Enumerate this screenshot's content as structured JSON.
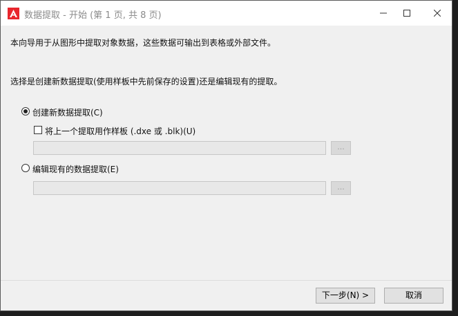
{
  "window": {
    "title": "数据提取 - 开始 (第 1 页, 共 8 页)"
  },
  "content": {
    "intro": "本向导用于从图形中提取对象数据，这些数据可输出到表格或外部文件。",
    "question": "选择是创建新数据提取(使用样板中先前保存的设置)还是编辑现有的提取。",
    "option_create": {
      "label": "创建新数据提取(C)",
      "selected": true
    },
    "checkbox_template": {
      "label": "将上一个提取用作样板 (.dxe 或 .blk)(U)",
      "checked": false
    },
    "option_edit": {
      "label": "编辑现有的数据提取(E)",
      "selected": false
    },
    "browse_label": "..."
  },
  "buttons": {
    "next": "下一步(N) >",
    "cancel": "取消"
  },
  "colors": {
    "dialog_bg": "#f0f0f0",
    "titlebar_bg": "#ffffff",
    "autocad_red": "#e8262c"
  },
  "icons": {
    "app": "autocad-logo-icon",
    "minimize": "minimize-icon",
    "maximize": "maximize-icon",
    "close": "close-icon"
  }
}
